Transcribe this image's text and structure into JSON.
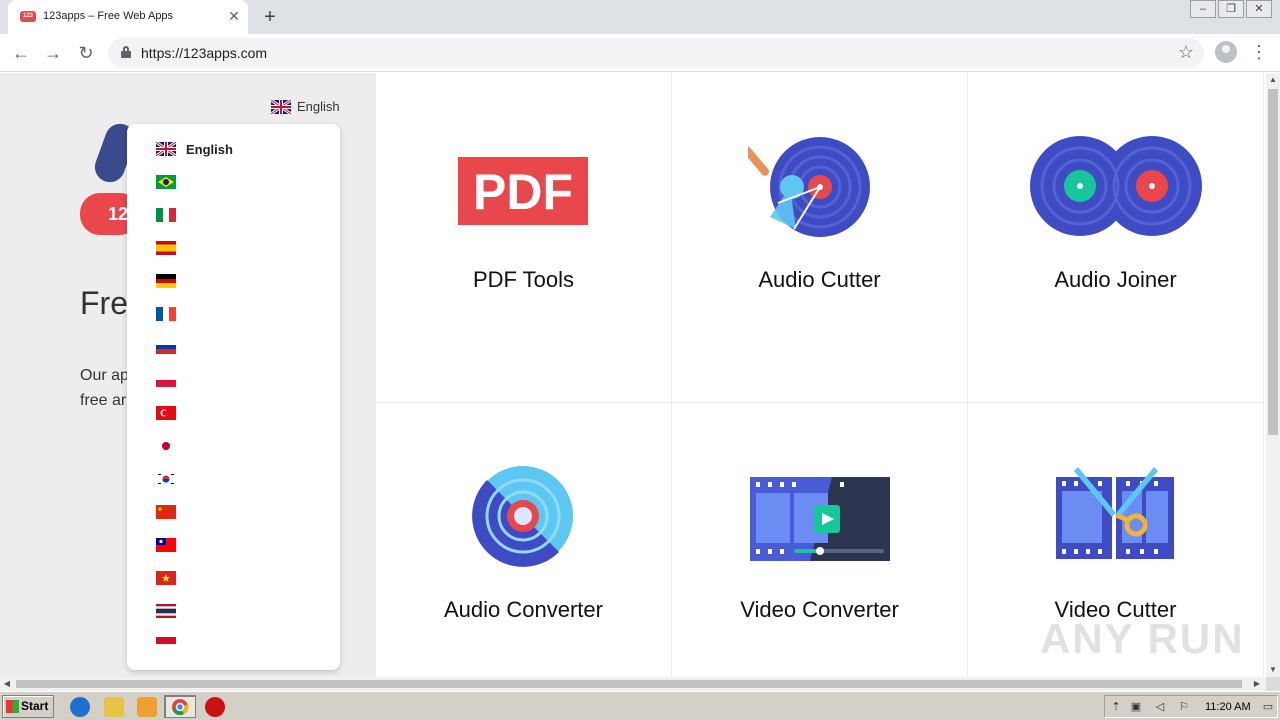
{
  "browser": {
    "tab_title": "123apps – Free Web Apps",
    "favicon_text": "123",
    "new_tab_label": "+",
    "url": "https://123apps.com"
  },
  "page": {
    "language_toggle": "English",
    "logo_text": "12",
    "hero_title": "Fre",
    "hero_text_line1": "Our ap",
    "hero_text_line2": "free ar"
  },
  "language_menu": {
    "items": [
      {
        "label": "English",
        "flag": "uk"
      },
      {
        "label": "",
        "flag": "brazil"
      },
      {
        "label": "",
        "flag": "italy"
      },
      {
        "label": "",
        "flag": "spain"
      },
      {
        "label": "",
        "flag": "germany"
      },
      {
        "label": "",
        "flag": "france"
      },
      {
        "label": "",
        "flag": "russia"
      },
      {
        "label": "",
        "flag": "poland"
      },
      {
        "label": "",
        "flag": "turkey"
      },
      {
        "label": "",
        "flag": "japan"
      },
      {
        "label": "",
        "flag": "korea"
      },
      {
        "label": "",
        "flag": "china"
      },
      {
        "label": "",
        "flag": "taiwan"
      },
      {
        "label": "",
        "flag": "vietnam"
      },
      {
        "label": "",
        "flag": "thailand"
      },
      {
        "label": "",
        "flag": "indonesia"
      }
    ]
  },
  "tools": [
    {
      "label": "PDF Tools",
      "icon": "pdf-icon"
    },
    {
      "label": "Audio Cutter",
      "icon": "audio-cutter-icon"
    },
    {
      "label": "Audio Joiner",
      "icon": "audio-joiner-icon"
    },
    {
      "label": "Audio Converter",
      "icon": "audio-converter-icon"
    },
    {
      "label": "Video Converter",
      "icon": "video-converter-icon"
    },
    {
      "label": "Video Cutter",
      "icon": "video-cutter-icon"
    }
  ],
  "taskbar": {
    "start_label": "Start",
    "clock": "11:20 AM"
  },
  "watermark": "ANY RUN",
  "colors": {
    "brand_red": "#e8474c",
    "disc_blue": "#3f4bc2",
    "disc_light": "#5dc7f2",
    "teal": "#17c69b"
  }
}
